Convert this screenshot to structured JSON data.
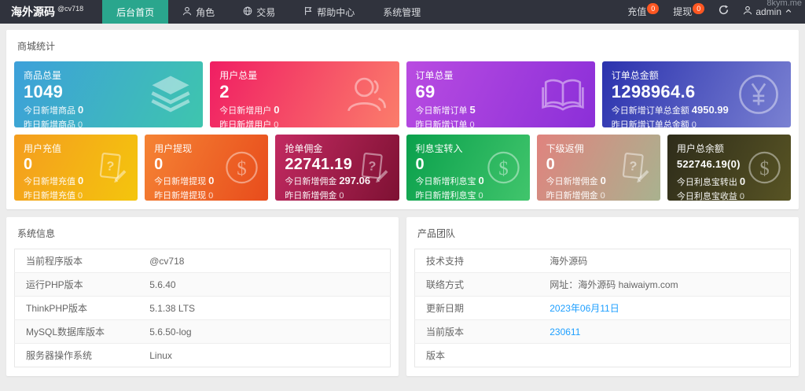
{
  "watermark": "8kym.me",
  "theme": {
    "navbar_bg": "#30333d",
    "active_tab": "#2aa68d",
    "badge": "#ff5722",
    "link": "#1e9fff",
    "page_bg": "#ececec",
    "panel_bg": "#ffffff"
  },
  "navbar": {
    "brand": "海外源码",
    "brand_badge": "@cv718",
    "menu": [
      {
        "label": "后台首页",
        "icon": null,
        "active": true
      },
      {
        "label": "角色",
        "icon": "user-icon",
        "active": false
      },
      {
        "label": "交易",
        "icon": "globe-icon",
        "active": false
      },
      {
        "label": "帮助中心",
        "icon": "flag-icon",
        "active": false
      },
      {
        "label": "系统管理",
        "icon": null,
        "active": false
      }
    ],
    "right": {
      "recharge_label": "充值",
      "recharge_badge": "0",
      "withdraw_label": "提现",
      "withdraw_badge": "0",
      "refresh_icon": "refresh-icon",
      "user_label": "admin"
    }
  },
  "stats": {
    "title": "商城统计",
    "cards": [
      {
        "title": "商品总量",
        "value": "1049",
        "line1_label": "今日新增商品",
        "line1_value": "0",
        "line2_label": "昨日新增商品",
        "line2_value": "0",
        "icon": "layers-icon",
        "gradient": {
          "from": "#3da0da",
          "to": "#3ec5ae"
        }
      },
      {
        "title": "用户总量",
        "value": "2",
        "line1_label": "今日新增用户",
        "line1_value": "0",
        "line2_label": "昨日新增用户",
        "line2_value": "0",
        "icon": "users-icon",
        "gradient": {
          "from": "#f01e63",
          "to": "#fb7d6b"
        }
      },
      {
        "title": "订单总量",
        "value": "69",
        "line1_label": "今日新增订单",
        "line1_value": "5",
        "line2_label": "昨日新增订单",
        "line2_value": "0",
        "icon": "book-icon",
        "gradient": {
          "from": "#b94ce1",
          "to": "#8b2fd8"
        }
      },
      {
        "title": "订单总金额",
        "value": "1298964.6",
        "line1_label": "今日新增订单总金额",
        "line1_value": "4950.99",
        "line2_label": "昨日新增订单总金额",
        "line2_value": "0",
        "icon": "yen-circle-icon",
        "gradient": {
          "from": "#2b32ae",
          "to": "#7a81d2"
        }
      },
      {
        "title": "用户充值",
        "value": "0",
        "line1_label": "今日新增充值",
        "line1_value": "0",
        "line2_label": "昨日新增充值",
        "line2_value": "0",
        "icon": "question-doc-icon",
        "gradient": {
          "from": "#f49d1f",
          "to": "#f4c50d"
        }
      },
      {
        "title": "用户提现",
        "value": "0",
        "line1_label": "今日新增提现",
        "line1_value": "0",
        "line2_label": "昨日新增提现",
        "line2_value": "0",
        "icon": "dollar-circle-icon",
        "gradient": {
          "from": "#f58334",
          "to": "#e84c1c"
        }
      },
      {
        "title": "抢单佣金",
        "value": "22741.19",
        "line1_label": "今日新增佣金",
        "line1_value": "297.06",
        "line2_label": "昨日新增佣金",
        "line2_value": "0",
        "icon": "question-doc-icon",
        "gradient": {
          "from": "#c22a61",
          "to": "#7e1133"
        }
      },
      {
        "title": "利息宝转入",
        "value": "0",
        "line1_label": "今日新增利息宝",
        "line1_value": "0",
        "line2_label": "昨日新增利息宝",
        "line2_value": "0",
        "icon": "dollar-circle-icon",
        "gradient": {
          "from": "#0aa04c",
          "to": "#41c56c"
        }
      },
      {
        "title": "下级返佣",
        "value": "0",
        "line1_label": "今日新增佣金",
        "line1_value": "0",
        "line2_label": "昨日新增佣金",
        "line2_value": "0",
        "icon": "question-doc-icon",
        "gradient": {
          "from": "#e0837e",
          "to": "#a9b28f"
        }
      },
      {
        "title": "用户总余额",
        "value": "522746.19(0)",
        "line1_label": "今日利息宝转出",
        "line1_value": "0",
        "line2_label": "今日利息宝收益",
        "line2_value": "0",
        "icon": "dollar-circle-icon",
        "gradient": {
          "from": "#2e2c1a",
          "to": "#585424"
        }
      }
    ]
  },
  "system_info": {
    "title": "系统信息",
    "rows": [
      {
        "label": "当前程序版本",
        "value": "@cv718"
      },
      {
        "label": "运行PHP版本",
        "value": "5.6.40"
      },
      {
        "label": "ThinkPHP版本",
        "value": "5.1.38 LTS"
      },
      {
        "label": "MySQL数据库版本",
        "value": "5.6.50-log"
      },
      {
        "label": "服务器操作系统",
        "value": "Linux"
      }
    ]
  },
  "team": {
    "title": "产品团队",
    "rows": [
      {
        "label": "技术支持",
        "value": "海外源码"
      },
      {
        "label": "联络方式",
        "value": "网址：海外源码 haiwaiym.com"
      },
      {
        "label": "更新日期",
        "value": "2023年06月11日"
      },
      {
        "label": "当前版本",
        "value": "230611"
      },
      {
        "label": "版本",
        "value": ""
      }
    ]
  }
}
